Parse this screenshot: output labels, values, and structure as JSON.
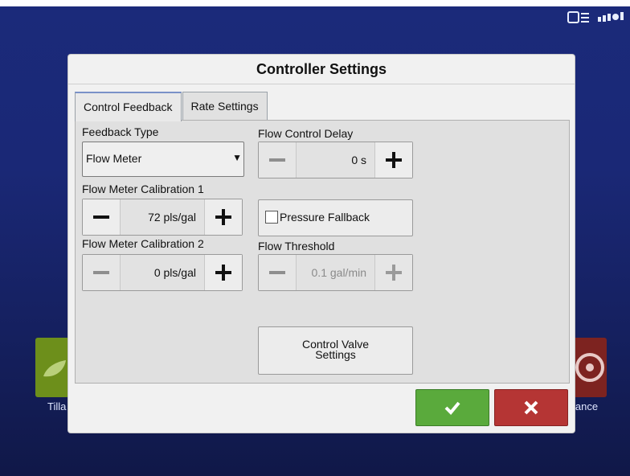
{
  "dialog": {
    "title": "Controller Settings",
    "tabs": [
      {
        "label": "Control Feedback",
        "active": true
      },
      {
        "label": "Rate Settings",
        "active": false
      }
    ]
  },
  "feedback_type": {
    "label": "Feedback Type",
    "value": "Flow Meter"
  },
  "flow_control_delay": {
    "label": "Flow Control Delay",
    "value": "0 s"
  },
  "flow_meter_cal_1": {
    "label": "Flow Meter Calibration 1",
    "value": "72 pls/gal"
  },
  "pressure_fallback": {
    "label": "Pressure Fallback",
    "checked": false
  },
  "flow_meter_cal_2": {
    "label": "Flow Meter Calibration 2",
    "value": "0 pls/gal"
  },
  "flow_threshold": {
    "label": "Flow Threshold",
    "value": "0.1 gal/min"
  },
  "control_valve_button": {
    "line1": "Control Valve",
    "line2": "Settings"
  },
  "background": {
    "left_tile_label": "Tilla",
    "right_tile_label": "lance"
  },
  "colors": {
    "ok": "#5aaa3c",
    "cancel": "#b53534",
    "background": "#1b2a7a"
  },
  "icons": {
    "ok": "checkmark-icon",
    "cancel": "x-icon",
    "status_1": "display-icon",
    "status_2": "gps-satellite-icon"
  }
}
